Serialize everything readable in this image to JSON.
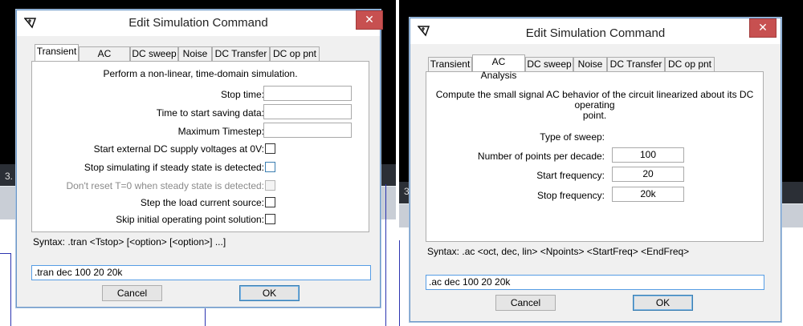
{
  "background": {
    "left_tag": "3.",
    "right_tag": "3."
  },
  "dialog_left": {
    "title": "Edit Simulation Command",
    "close_glyph": "✕",
    "tabs": [
      "Transient",
      "AC Analysis",
      "DC sweep",
      "Noise",
      "DC Transfer",
      "DC op pnt"
    ],
    "description": "Perform a non-linear, time-domain simulation.",
    "fields": [
      {
        "label": "Stop time:",
        "value": ""
      },
      {
        "label": "Time to start saving data:",
        "value": ""
      },
      {
        "label": "Maximum Timestep:",
        "value": ""
      }
    ],
    "checkboxes": [
      {
        "label": "Start external DC supply voltages at 0V:"
      },
      {
        "label": "Stop simulating if steady state is detected:"
      },
      {
        "label": "Don't reset T=0 when steady state is detected:"
      },
      {
        "label": "Step the load current source:"
      },
      {
        "label": "Skip initial operating point solution:"
      }
    ],
    "syntax": "Syntax:  .tran <Tstop> [<option> [<option>] ...]",
    "command": ".tran dec 100 20 20k",
    "cancel": "Cancel",
    "ok": "OK"
  },
  "dialog_right": {
    "title": "Edit Simulation Command",
    "close_glyph": "✕",
    "tabs": [
      "Transient",
      "AC Analysis",
      "DC sweep",
      "Noise",
      "DC Transfer",
      "DC op pnt"
    ],
    "description_line1": "Compute the small signal AC behavior of the circuit linearized about its DC operating",
    "description_line2": "point.",
    "type_of_sweep_label": "Type of sweep:",
    "fields": [
      {
        "label": "Number of points per decade:",
        "value": "100"
      },
      {
        "label": "Start frequency:",
        "value": "20"
      },
      {
        "label": "Stop frequency:",
        "value": "20k"
      }
    ],
    "syntax": "Syntax:  .ac <oct, dec, lin> <Npoints> <StartFreq> <EndFreq>",
    "command": ".ac dec 100 20 20k",
    "cancel": "Cancel",
    "ok": "OK"
  }
}
